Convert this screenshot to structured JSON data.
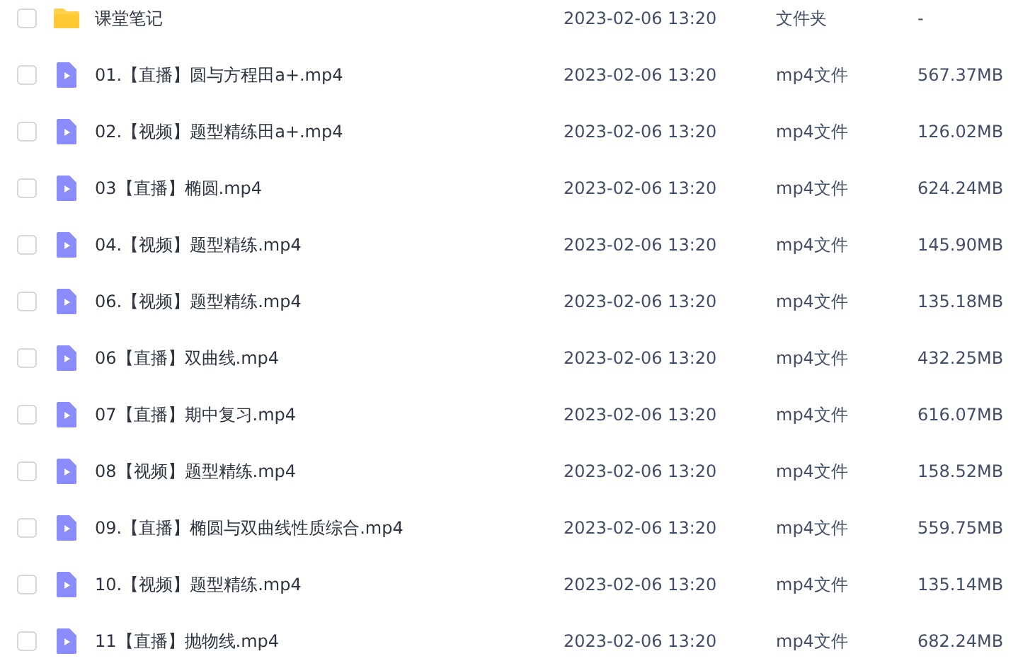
{
  "files": [
    {
      "kind": "folder",
      "name": "课堂笔记",
      "modified": "2023-02-06 13:20",
      "type": "文件夹",
      "size": "-",
      "checked": false
    },
    {
      "kind": "video",
      "name": "01.【直播】圆与方程田a+.mp4",
      "modified": "2023-02-06 13:20",
      "type": "mp4文件",
      "size": "567.37MB",
      "checked": false
    },
    {
      "kind": "video",
      "name": "02.【视频】题型精练田a+.mp4",
      "modified": "2023-02-06 13:20",
      "type": "mp4文件",
      "size": "126.02MB",
      "checked": false
    },
    {
      "kind": "video",
      "name": "03【直播】椭圆.mp4",
      "modified": "2023-02-06 13:20",
      "type": "mp4文件",
      "size": "624.24MB",
      "checked": false
    },
    {
      "kind": "video",
      "name": "04.【视频】题型精练.mp4",
      "modified": "2023-02-06 13:20",
      "type": "mp4文件",
      "size": "145.90MB",
      "checked": false
    },
    {
      "kind": "video",
      "name": "06.【视频】题型精练.mp4",
      "modified": "2023-02-06 13:20",
      "type": "mp4文件",
      "size": "135.18MB",
      "checked": false
    },
    {
      "kind": "video",
      "name": "06【直播】双曲线.mp4",
      "modified": "2023-02-06 13:20",
      "type": "mp4文件",
      "size": "432.25MB",
      "checked": false
    },
    {
      "kind": "video",
      "name": "07【直播】期中复习.mp4",
      "modified": "2023-02-06 13:20",
      "type": "mp4文件",
      "size": "616.07MB",
      "checked": false
    },
    {
      "kind": "video",
      "name": "08【视频】题型精练.mp4",
      "modified": "2023-02-06 13:20",
      "type": "mp4文件",
      "size": "158.52MB",
      "checked": false
    },
    {
      "kind": "video",
      "name": "09.【直播】椭圆与双曲线性质综合.mp4",
      "modified": "2023-02-06 13:20",
      "type": "mp4文件",
      "size": "559.75MB",
      "checked": false
    },
    {
      "kind": "video",
      "name": "10.【视频】题型精练.mp4",
      "modified": "2023-02-06 13:20",
      "type": "mp4文件",
      "size": "135.14MB",
      "checked": false
    },
    {
      "kind": "video",
      "name": "11【直播】抛物线.mp4",
      "modified": "2023-02-06 13:20",
      "type": "mp4文件",
      "size": "682.24MB",
      "checked": false
    }
  ]
}
